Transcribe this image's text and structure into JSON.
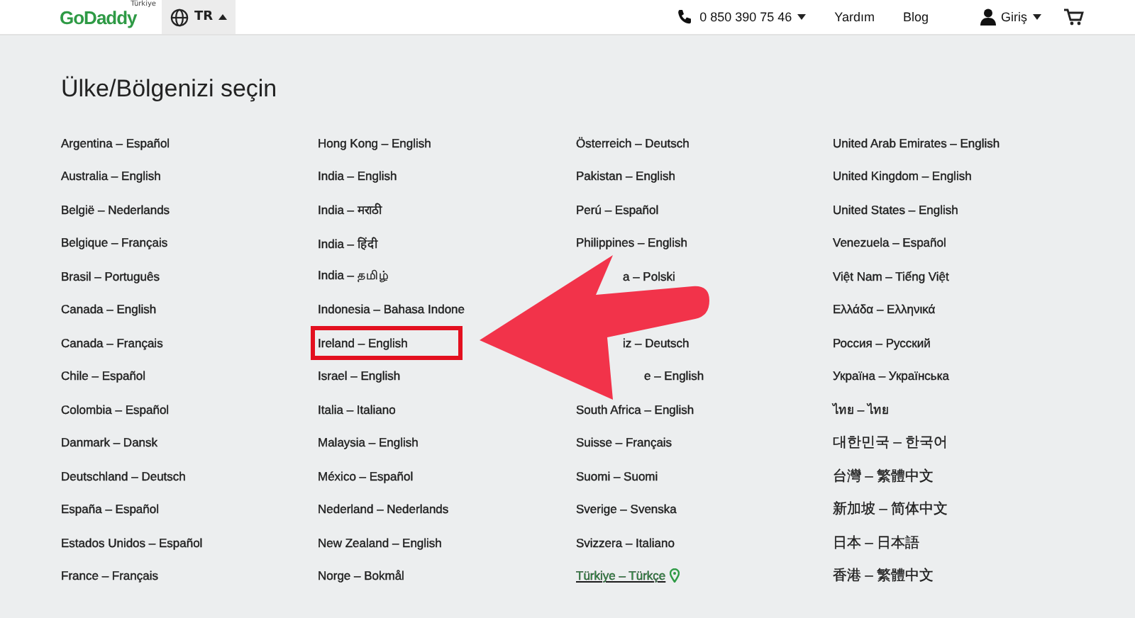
{
  "header": {
    "logo": "GoDaddy",
    "logo_region": "Türkiye",
    "locale": "TR",
    "phone": "0 850 390 75 46",
    "links": [
      "Yardım",
      "Blog"
    ],
    "login": "Giriş"
  },
  "title": "Ülke/Bölgenizi seçin",
  "columns": [
    [
      {
        "text": "Argentina – Español",
        "selected": false
      },
      {
        "text": "Australia – English",
        "selected": false
      },
      {
        "text": "België – Nederlands",
        "selected": false
      },
      {
        "text": "Belgique – Français",
        "selected": false
      },
      {
        "text": "Brasil – Português",
        "selected": false
      },
      {
        "text": "Canada – English",
        "selected": false
      },
      {
        "text": "Canada – Français",
        "selected": false
      },
      {
        "text": "Chile – Español",
        "selected": false
      },
      {
        "text": "Colombia – Español",
        "selected": false
      },
      {
        "text": "Danmark – Dansk",
        "selected": false
      },
      {
        "text": "Deutschland – Deutsch",
        "selected": false
      },
      {
        "text": "España – Español",
        "selected": false
      },
      {
        "text": "Estados Unidos – Español",
        "selected": false
      },
      {
        "text": "France – Français",
        "selected": false
      }
    ],
    [
      {
        "text": "Hong Kong – English",
        "selected": false
      },
      {
        "text": "India – English",
        "selected": false
      },
      {
        "text": "India – मराठी",
        "selected": false
      },
      {
        "text": "India – हिंदी",
        "selected": false
      },
      {
        "text": "India – தமிழ்",
        "selected": false
      },
      {
        "text": "Indonesia – Bahasa Indone",
        "selected": false
      },
      {
        "text": "Ireland – English",
        "selected": false,
        "highlighted": true
      },
      {
        "text": "Israel – English",
        "selected": false
      },
      {
        "text": "Italia – Italiano",
        "selected": false
      },
      {
        "text": "Malaysia – English",
        "selected": false
      },
      {
        "text": "México – Español",
        "selected": false
      },
      {
        "text": "Nederland – Nederlands",
        "selected": false
      },
      {
        "text": "New Zealand – English",
        "selected": false
      },
      {
        "text": "Norge – Bokmål",
        "selected": false
      }
    ],
    [
      {
        "text": "Österreich – Deutsch",
        "selected": false
      },
      {
        "text": "Pakistan – English",
        "selected": false
      },
      {
        "text": "Perú – Español",
        "selected": false
      },
      {
        "text": "Philippines – English",
        "selected": false
      },
      {
        "kind": "covered",
        "text": "a – Polski",
        "selected": false
      },
      {
        "kind": "hidden"
      },
      {
        "kind": "covered",
        "text": "iz – Deutsch",
        "selected": false
      },
      {
        "kind": "covered-wide",
        "text": "e – English",
        "selected": false
      },
      {
        "text": "South Africa – English",
        "selected": false
      },
      {
        "text": "Suisse – Français",
        "selected": false
      },
      {
        "text": "Suomi – Suomi",
        "selected": false
      },
      {
        "text": "Sverige – Svenska",
        "selected": false
      },
      {
        "text": "Svizzera – Italiano",
        "selected": false
      },
      {
        "text": "Türkiye – Türkçe",
        "selected": true
      }
    ],
    [
      {
        "text": "United Arab Emirates – English",
        "selected": false
      },
      {
        "text": "United Kingdom – English",
        "selected": false
      },
      {
        "text": "United States – English",
        "selected": false
      },
      {
        "text": "Venezuela – Español",
        "selected": false
      },
      {
        "text": "Việt Nam – Tiếng Việt",
        "selected": false
      },
      {
        "text": "Ελλάδα – Ελληνικά",
        "selected": false
      },
      {
        "text": "Россия – Русский",
        "selected": false
      },
      {
        "text": "Україна – Українська",
        "selected": false
      },
      {
        "text": "ไทย – ไทย",
        "selected": false
      },
      {
        "kind": "cjk",
        "text": "대한민국 – 한국어",
        "selected": false
      },
      {
        "kind": "cjk",
        "text": "台灣 – 繁體中文",
        "selected": false
      },
      {
        "kind": "cjk",
        "text": "新加坡 – 简体中文",
        "selected": false
      },
      {
        "kind": "cjk",
        "text": "日本 – 日本語",
        "selected": false
      },
      {
        "kind": "cjk",
        "text": "香港 – 繁體中文",
        "selected": false
      }
    ]
  ]
}
